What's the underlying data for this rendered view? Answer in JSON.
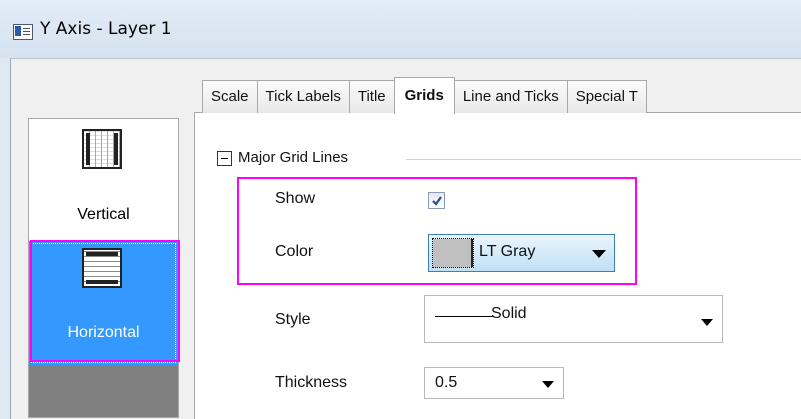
{
  "window": {
    "title": "Y Axis - Layer 1",
    "icon": "window-icon"
  },
  "tabs": [
    {
      "label": "Scale",
      "active": false
    },
    {
      "label": "Tick Labels",
      "active": false
    },
    {
      "label": "Title",
      "active": false
    },
    {
      "label": "Grids",
      "active": true
    },
    {
      "label": "Line and Ticks",
      "active": false
    },
    {
      "label": "Special T",
      "active": false
    }
  ],
  "sidebar": {
    "items": [
      {
        "label": "Vertical",
        "icon": "vertical-grid-icon",
        "selected": false
      },
      {
        "label": "Horizontal",
        "icon": "horizontal-grid-icon",
        "selected": true
      }
    ]
  },
  "major_grid": {
    "group_title": "Major Grid Lines",
    "show_label": "Show",
    "show_checked": true,
    "color_label": "Color",
    "color_value": "LT Gray",
    "color_swatch": "#c0c0c0",
    "style_label": "Style",
    "style_value": "Solid",
    "thickness_label": "Thickness",
    "thickness_value": "0.5"
  },
  "colors": {
    "highlight": "#ff00ff",
    "selection": "#3399ff"
  }
}
